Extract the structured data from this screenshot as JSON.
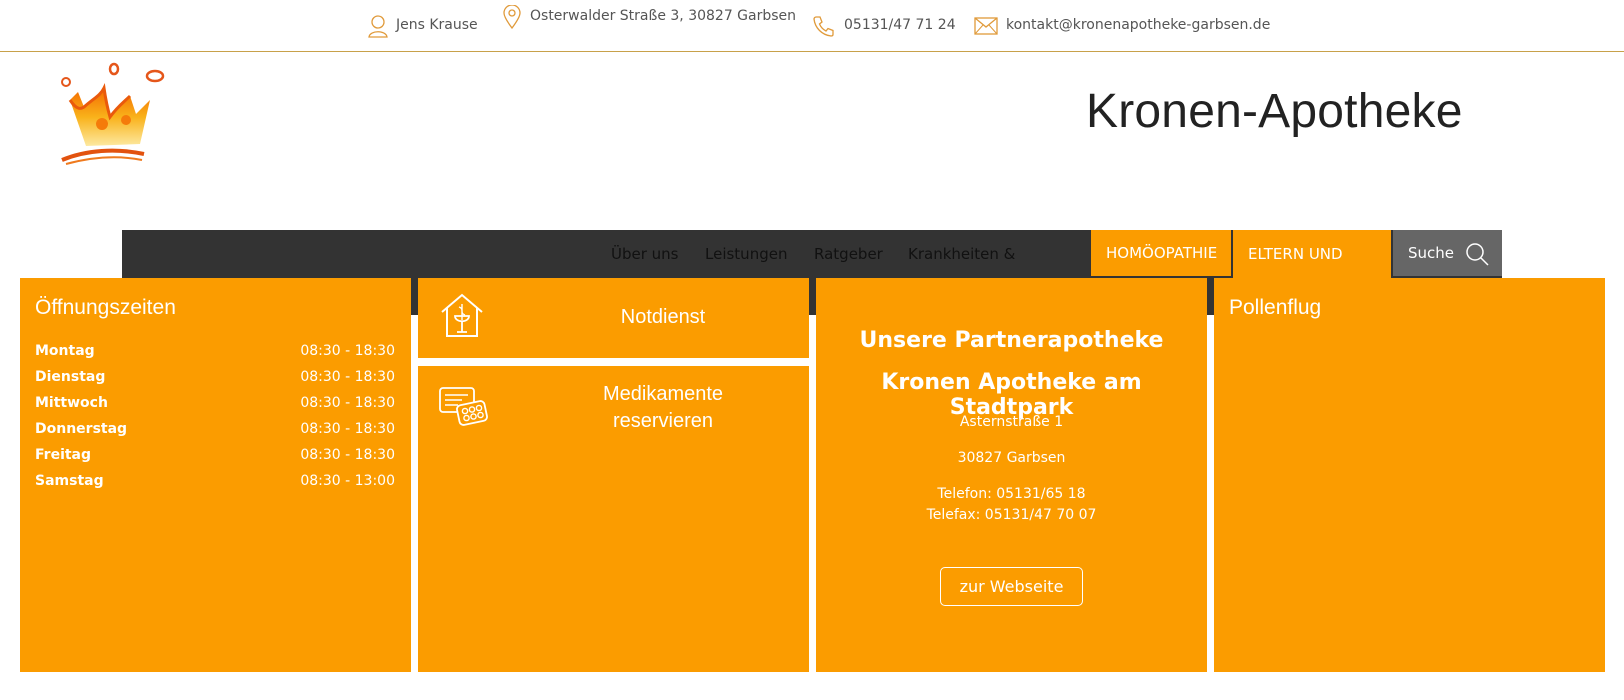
{
  "contact": {
    "name": "Jens Krause",
    "address": "Osterwalder Straße 3, 30827 Garbsen",
    "phone": "05131/47 71 24",
    "email": "kontakt@kronenapotheke-garbsen.de"
  },
  "site": {
    "title": "Kronen-Apotheke"
  },
  "nav": {
    "items": [
      "Über uns",
      "Leistungen",
      "Ratgeber",
      "Krankheiten &"
    ],
    "highlight": [
      "HOMÖOPATHIE",
      "ELTERN UND"
    ],
    "search_label": "Suche"
  },
  "hours": {
    "title": "Öffnungszeiten",
    "rows": [
      {
        "day": "Montag",
        "time": "08:30 - 18:30"
      },
      {
        "day": "Dienstag",
        "time": "08:30 - 18:30"
      },
      {
        "day": "Mittwoch",
        "time": "08:30 - 18:30"
      },
      {
        "day": "Donnerstag",
        "time": "08:30 - 18:30"
      },
      {
        "day": "Freitag",
        "time": "08:30 - 18:30"
      },
      {
        "day": "Samstag",
        "time": "08:30 - 13:00"
      }
    ]
  },
  "tiles": {
    "notdienst": "Notdienst",
    "reserve_line1": "Medikamente",
    "reserve_line2": "reservieren"
  },
  "partner": {
    "heading1": "Unsere Partnerapotheke",
    "heading2": "Kronen Apotheke am Stadtpark",
    "street": "Asternstraße 1",
    "city": "30827 Garbsen",
    "phone": "Telefon: 05131/65 18",
    "fax": "Telefax: 05131/47 70 07",
    "button": "zur Webseite"
  },
  "pollen": {
    "title": "Pollenflug"
  },
  "colors": {
    "accent": "#fb9c00",
    "nav_bg": "#333333",
    "search_bg": "#666666",
    "rule": "#c8a14a"
  }
}
